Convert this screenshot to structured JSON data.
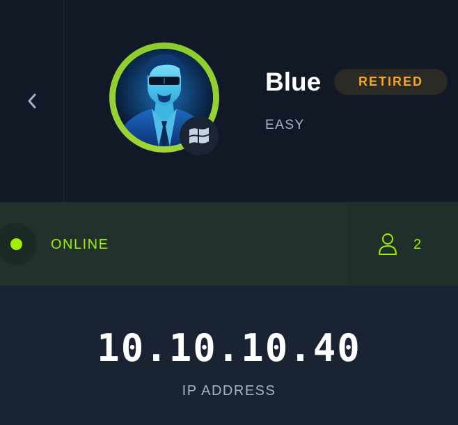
{
  "machine": {
    "name": "Blue",
    "status": "RETIRED",
    "difficulty": "EASY",
    "os_icon": "windows-icon",
    "avatar_icon": "agent-avatar"
  },
  "connection": {
    "state": "ONLINE",
    "users_icon": "user-icon",
    "users_count": "2"
  },
  "target": {
    "ip": "10.10.10.40",
    "ip_label": "IP ADDRESS"
  },
  "nav": {
    "back_icon": "chevron-left-icon"
  },
  "colors": {
    "accent_green": "#9fef00",
    "retired_orange": "#f5a623",
    "background": "#1a2332",
    "header_background": "#111927"
  }
}
